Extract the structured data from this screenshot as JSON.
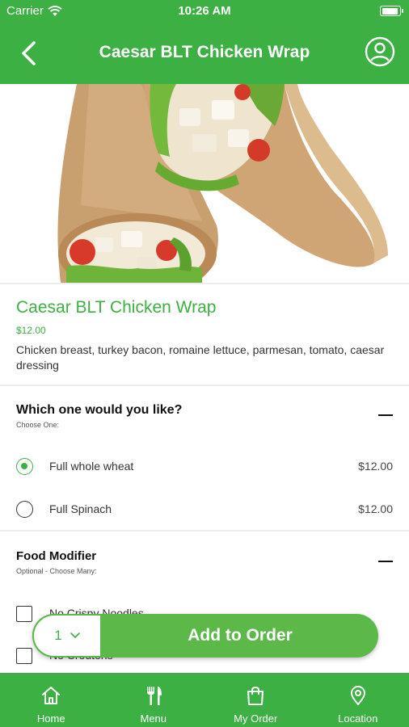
{
  "status_bar": {
    "carrier": "Carrier",
    "time": "10:26 AM"
  },
  "nav": {
    "title": "Caesar BLT Chicken Wrap",
    "back_icon": "chevron-left-icon",
    "profile_icon": "user-circle-icon"
  },
  "item": {
    "name": "Caesar BLT Chicken Wrap",
    "price": "$12.00",
    "description": "Chicken breast, turkey bacon, romaine lettuce, parmesan, tomato, caesar dressing"
  },
  "groups": [
    {
      "title": "Which one would you like?",
      "subtitle": "Choose One:",
      "options": [
        {
          "label": "Full whole wheat",
          "price": "$12.00",
          "selected": true
        },
        {
          "label": "Full Spinach",
          "price": "$12.00",
          "selected": false
        }
      ]
    },
    {
      "title": "Food Modifier",
      "subtitle": "Optional - Choose Many:",
      "options": [
        {
          "label": "No Crispy Noodles",
          "checked": false
        },
        {
          "label": "No Croutons",
          "checked": false
        }
      ]
    }
  ],
  "order": {
    "quantity": "1",
    "add_label": "Add to Order"
  },
  "tabs": [
    {
      "label": "Home",
      "icon": "home-icon"
    },
    {
      "label": "Menu",
      "icon": "utensils-icon"
    },
    {
      "label": "My Order",
      "icon": "shopping-bag-icon"
    },
    {
      "label": "Location",
      "icon": "map-pin-icon"
    }
  ],
  "colors": {
    "brand_green": "#3cb043",
    "button_green": "#5db84a"
  }
}
